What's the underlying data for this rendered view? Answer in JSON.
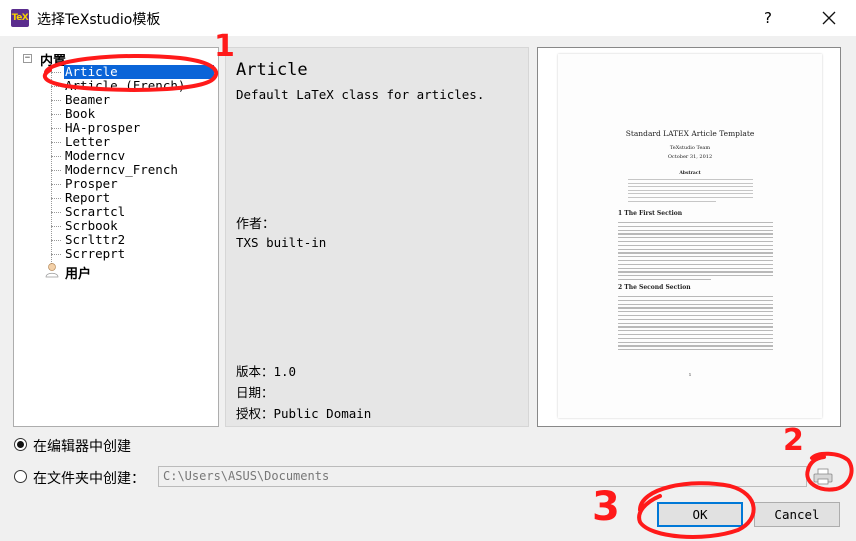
{
  "window": {
    "icon_text": "TeX",
    "title": "选择TeXstudio模板",
    "help_label": "?"
  },
  "tree": {
    "builtin_label": "内置",
    "items": [
      "Article",
      "Article (French)",
      "Beamer",
      "Book",
      "HA-prosper",
      "Letter",
      "Moderncv",
      "Moderncv_French",
      "Prosper",
      "Report",
      "Scrartcl",
      "Scrbook",
      "Scrlttr2",
      "Scrreprt"
    ],
    "selected": "Article",
    "user_label": "用户"
  },
  "info": {
    "name": "Article",
    "description": "Default LaTeX class for articles.",
    "author_label": "作者：",
    "author": "TXS built-in",
    "version": "版本：1.0",
    "date": "日期：",
    "license": "授权：Public Domain"
  },
  "preview": {
    "title": "Standard LATEX Article Template",
    "author": "TeXstudio Team",
    "date": "October 31, 2012",
    "abstract_heading": "Abstract",
    "section1": "1   The First Section",
    "section2": "2   The Second Section",
    "page_number": "1"
  },
  "options": {
    "create_in_editor": "在编辑器中创建",
    "create_in_folder": "在文件夹中创建：",
    "selected_option": "create_in_editor",
    "folder_path": "C:\\Users\\ASUS\\Documents"
  },
  "buttons": {
    "ok": "OK",
    "cancel": "Cancel"
  },
  "annotations": {
    "mark1": "1",
    "mark2": "2",
    "mark3": "3",
    "color": "#ff1a1a"
  },
  "icons": {
    "close": "close-icon",
    "browse": "printer-icon",
    "user": "user-icon",
    "expander": "minus-icon"
  }
}
